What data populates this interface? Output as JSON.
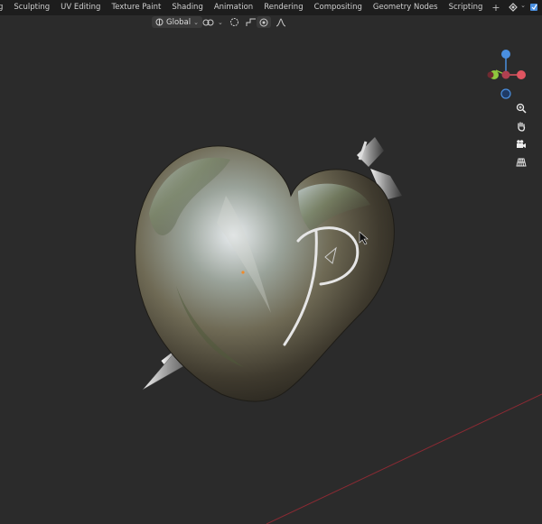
{
  "workspace_tabs": [
    {
      "label": "g"
    },
    {
      "label": "Sculpting"
    },
    {
      "label": "UV Editing"
    },
    {
      "label": "Texture Paint"
    },
    {
      "label": "Shading"
    },
    {
      "label": "Animation"
    },
    {
      "label": "Rendering"
    },
    {
      "label": "Compositing"
    },
    {
      "label": "Geometry Nodes"
    },
    {
      "label": "Scripting"
    }
  ],
  "add_tab_label": "+",
  "viewport_header": {
    "transform_orientation": "Global"
  },
  "gizmo": {
    "axes": [
      {
        "axis": "X",
        "color": "#e05561"
      },
      {
        "axis": "Y",
        "color": "#8fc73e"
      },
      {
        "axis": "Z",
        "color": "#4a8fe0"
      }
    ]
  },
  "nav_tools": [
    {
      "icon": "zoom-icon"
    },
    {
      "icon": "hand-pan-icon"
    },
    {
      "icon": "camera-icon"
    },
    {
      "icon": "grid-perspective-icon"
    }
  ],
  "colors": {
    "background": "#2b2b2b",
    "topbar": "#1d1d1d",
    "axis_x_line": "#8a2a33"
  }
}
